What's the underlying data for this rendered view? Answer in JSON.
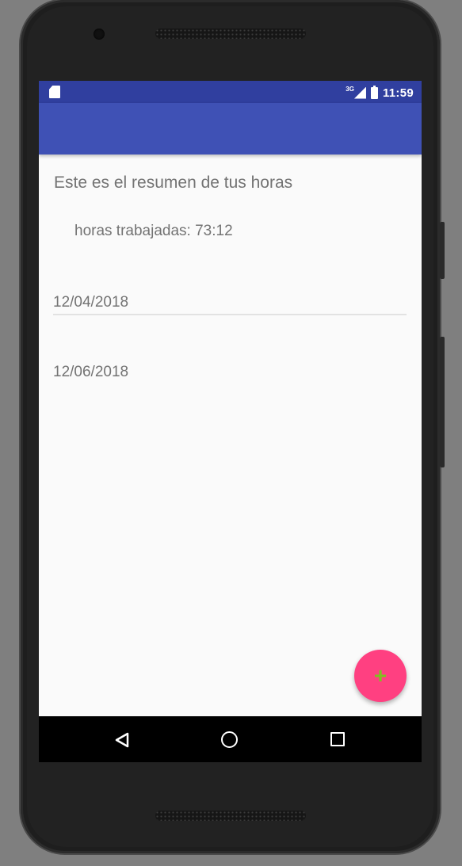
{
  "status_bar": {
    "network_type": "3G",
    "time": "11:59",
    "icons": [
      "sd-card-icon",
      "signal-icon",
      "battery-charging-icon"
    ]
  },
  "app_bar": {
    "title": ""
  },
  "summary": {
    "heading": "Este es el resumen de tus horas",
    "hours_text": "horas trabajadas: 73:12"
  },
  "dates": {
    "start_date": "12/04/2018",
    "end_date": "12/06/2018"
  },
  "fab": {
    "icon": "add-icon",
    "symbol": "+"
  },
  "nav_bar": {
    "icons": [
      "back-icon",
      "home-icon",
      "recents-icon"
    ]
  },
  "colors": {
    "status_bar": "#303f9f",
    "app_bar": "#3f51b5",
    "fab": "#ff4081",
    "fab_icon": "#7dc11f"
  }
}
